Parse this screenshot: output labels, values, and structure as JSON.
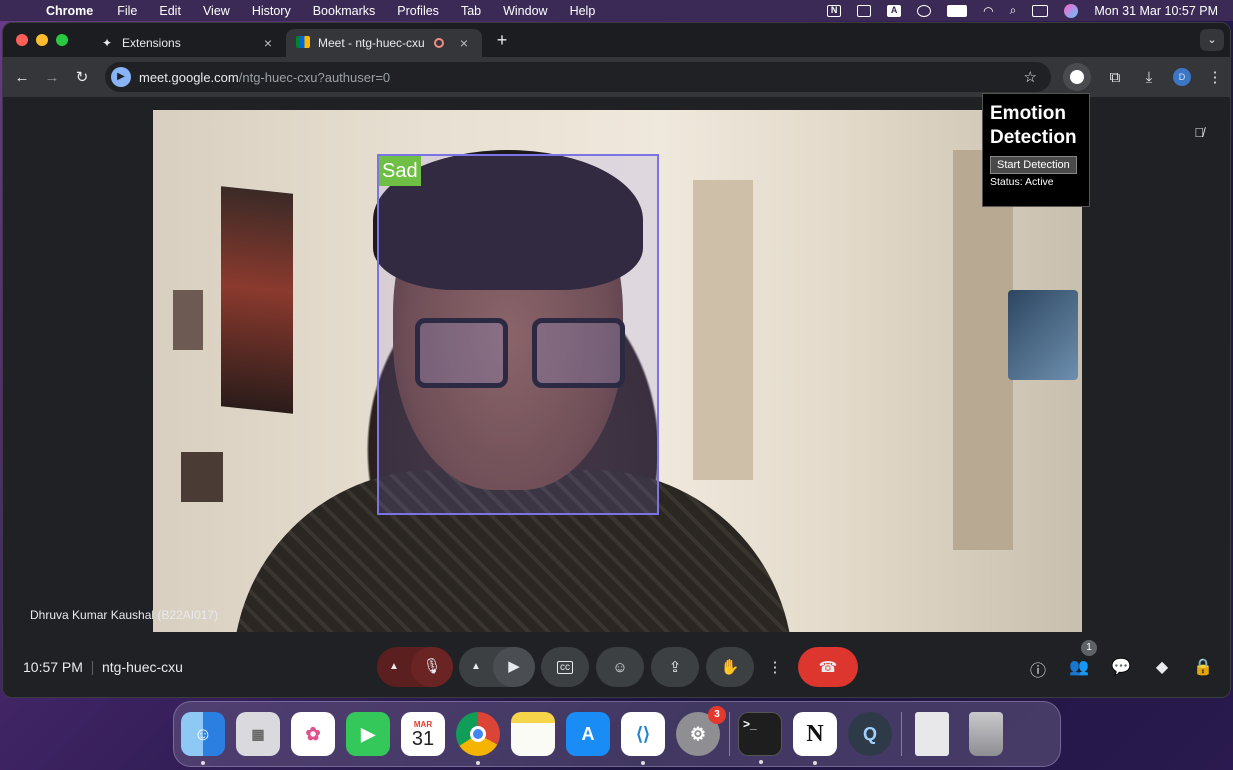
{
  "menubar": {
    "app_name": "Chrome",
    "menus": [
      "File",
      "Edit",
      "View",
      "History",
      "Bookmarks",
      "Profiles",
      "Tab",
      "Window",
      "Help"
    ],
    "status_icons": [
      "notion-menubar-icon",
      "screen-mirror-icon",
      "text-input-icon",
      "user-icon",
      "battery-icon",
      "wifi-icon",
      "search-icon",
      "control-center-icon",
      "siri-icon"
    ],
    "clock": "Mon 31 Mar  10:57 PM"
  },
  "browser": {
    "tabs": [
      {
        "label": "Extensions",
        "icon": "puzzle-icon",
        "active": false
      },
      {
        "label": "Meet - ntg-huec-cxu",
        "icon": "meet-icon",
        "active": true,
        "recording": true
      }
    ],
    "url_host": "meet.google.com",
    "url_path": "/ntg-huec-cxu?authuser=0",
    "profile_initial": "D"
  },
  "meet": {
    "participant_name": "Dhruva Kumar Kaushal (B22AI017)",
    "time": "10:57 PM",
    "meeting_code": "ntg-huec-cxu",
    "people_count": "1",
    "detected_emotion": "Sad"
  },
  "extension_popup": {
    "title": "Emotion Detection",
    "button_label": "Start Detection",
    "status": "Status: Active"
  },
  "dock": {
    "apps": [
      "Finder",
      "Launchpad",
      "Photos",
      "FaceTime",
      "Calendar",
      "Chrome",
      "Notes",
      "App Store",
      "VS Code",
      "System Settings",
      "Terminal",
      "Notion",
      "QuickTime",
      "Documents",
      "Trash"
    ],
    "calendar_month": "MAR",
    "calendar_day": "31",
    "settings_badge": "3"
  },
  "colors": {
    "hangup": "#dc362e",
    "face_box": "#7c73e6",
    "emotion_label": "#6fbf45"
  }
}
